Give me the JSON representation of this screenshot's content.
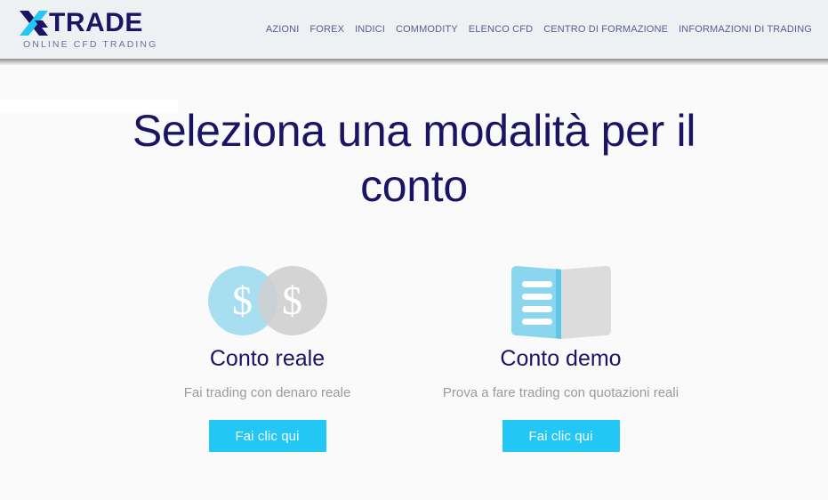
{
  "header": {
    "logo": {
      "icon": "x-mark-logo-icon",
      "word": "TRADE",
      "tagline": "ONLINE CFD TRADING",
      "accent_color": "#22c7f5",
      "dark_color": "#1b1464"
    },
    "nav": [
      {
        "label": "AZIONI"
      },
      {
        "label": "FOREX"
      },
      {
        "label": "INDICI"
      },
      {
        "label": "COMMODITY"
      },
      {
        "label": "ELENCO CFD"
      },
      {
        "label": "CENTRO DI FORMAZIONE"
      },
      {
        "label": "INFORMAZIONI DI TRADING"
      }
    ]
  },
  "main": {
    "title": "Seleziona una modalità per il conto",
    "options": [
      {
        "icon": "coins-dollar-icon",
        "title": "Conto reale",
        "subtitle": "Fai trading con denaro reale",
        "button_label": "Fai clic qui",
        "dollar_symbol": "$"
      },
      {
        "icon": "open-book-icon",
        "title": "Conto demo",
        "subtitle": "Prova a fare trading con quotazioni reali",
        "button_label": "Fai clic qui"
      }
    ]
  },
  "theme": {
    "page_background": "#fafafa",
    "header_background": "#edf1f4",
    "button_color": "#22c7f5",
    "heading_color": "#1b1464",
    "subtitle_color": "#9a9a9a",
    "icon_blue": "#a8dff0",
    "icon_gray": "#dcdcdc"
  }
}
